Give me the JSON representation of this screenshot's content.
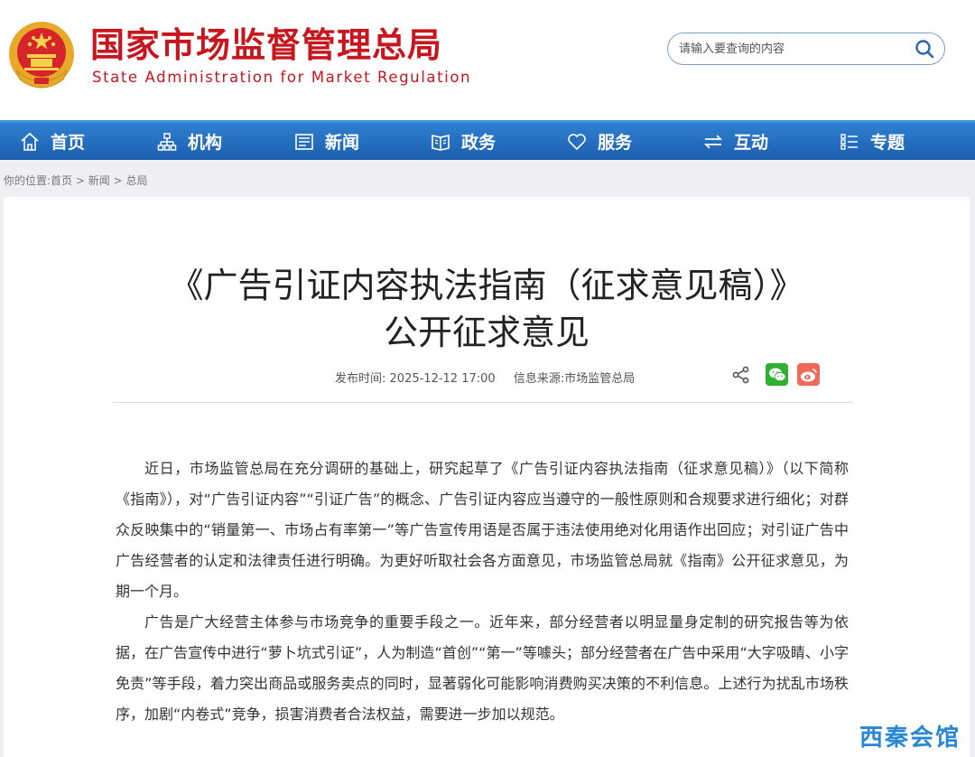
{
  "header": {
    "title_cn": "国家市场监督管理总局",
    "title_en": "State Administration for Market Regulation",
    "search_placeholder": "请输入要查询的内容",
    "brand_color": "#c8161e"
  },
  "nav": {
    "items": [
      {
        "label": "首页",
        "icon": "home-icon"
      },
      {
        "label": "机构",
        "icon": "org-chart-icon"
      },
      {
        "label": "新闻",
        "icon": "news-icon"
      },
      {
        "label": "政务",
        "icon": "book-icon"
      },
      {
        "label": "服务",
        "icon": "heart-icon"
      },
      {
        "label": "互动",
        "icon": "exchange-icon"
      },
      {
        "label": "专题",
        "icon": "list-icon"
      }
    ],
    "bg_color": "#1c5fb0"
  },
  "breadcrumb": {
    "prefix": "你的位置:",
    "items": [
      "首页",
      "新闻",
      "总局"
    ],
    "separator": " > "
  },
  "article": {
    "title_line1": "《广告引证内容执法指南（征求意见稿）》",
    "title_line2": "公开征求意见",
    "publish_label": "发布时间:",
    "publish_time": "2025-12-12 17:00",
    "source_label": "信息来源:",
    "source": "市场监管总局",
    "paragraphs": [
      "近日，市场监管总局在充分调研的基础上，研究起草了《广告引证内容执法指南（征求意见稿）》（以下简称《指南》），对“广告引证内容”“引证广告”的概念、广告引证内容应当遵守的一般性原则和合规要求进行细化；对群众反映集中的“销量第一、市场占有率第一”等广告宣传用语是否属于违法使用绝对化用语作出回应；对引证广告中广告经营者的认定和法律责任进行明确。为更好听取社会各方面意见，市场监管总局就《指南》公开征求意见，为期一个月。",
      "广告是广大经营主体参与市场竞争的重要手段之一。近年来，部分经营者以明显量身定制的研究报告等为依据，在广告宣传中进行“萝卜坑式引证”，人为制造“首创”“第一”等噱头；部分经营者在广告中采用“大字吸睛、小字免责”等手段，着力突出商品或服务卖点的同时，显著弱化可能影响消费购买决策的不利信息。上述行为扰乱市场秩序，加剧“内卷式”竞争，损害消费者合法权益，需要进一步加以规范。"
    ]
  },
  "watermark": "西秦会馆"
}
